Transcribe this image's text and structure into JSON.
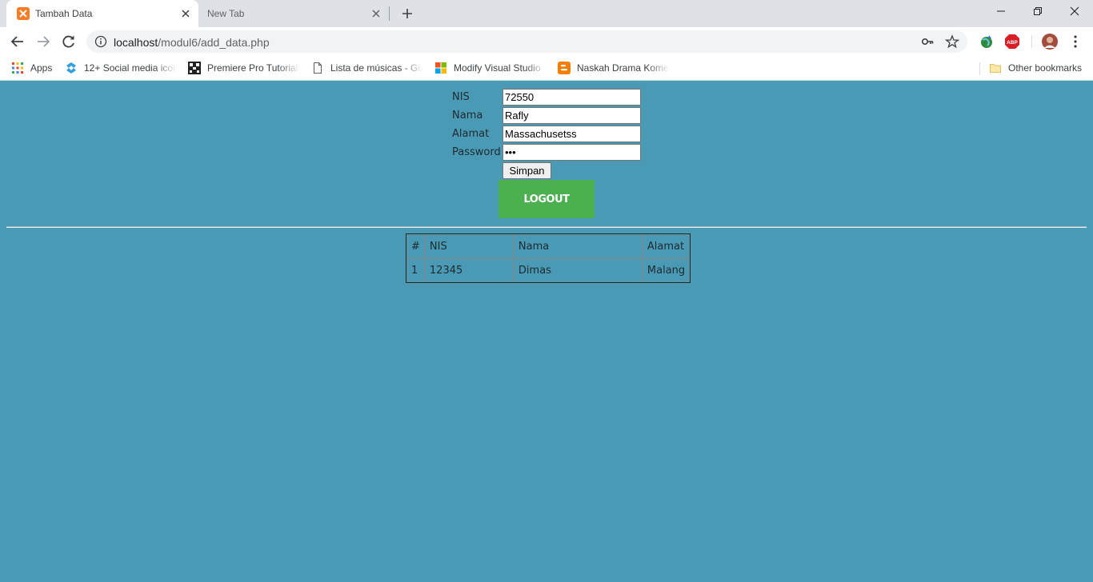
{
  "browser": {
    "tabs": [
      {
        "title": "Tambah Data",
        "active": true
      },
      {
        "title": "New Tab",
        "active": false
      }
    ],
    "url_host": "localhost",
    "url_path": "/modul6/add_data.php",
    "bookmarks": [
      {
        "label": "Apps",
        "icon": "apps-grid-icon"
      },
      {
        "label": "12+ Social media icon",
        "icon": "social-icon"
      },
      {
        "label": "Premiere Pro Tutorial",
        "icon": "premiere-icon"
      },
      {
        "label": "Lista de músicas - Gu",
        "icon": "page-icon"
      },
      {
        "label": "Modify Visual Studio",
        "icon": "microsoft-icon"
      },
      {
        "label": "Naskah Drama Kome",
        "icon": "blogger-icon"
      }
    ],
    "other_bookmarks": "Other bookmarks"
  },
  "form": {
    "nis_label": "NIS",
    "nis_value": "72550",
    "nama_label": "Nama",
    "nama_value": "Rafly",
    "alamat_label": "Alamat",
    "alamat_value": "Massachusetss",
    "password_label": "Password",
    "password_value": "abc",
    "submit_label": "Simpan",
    "logout_label": "LOGOUT"
  },
  "table": {
    "headers": [
      "#",
      "NIS",
      "Nama",
      "Alamat"
    ],
    "rows": [
      [
        "1",
        "12345",
        "Dimas",
        "Malang"
      ]
    ]
  },
  "colors": {
    "page_background": "#4a9ab5",
    "logout_button": "#4caf50"
  }
}
